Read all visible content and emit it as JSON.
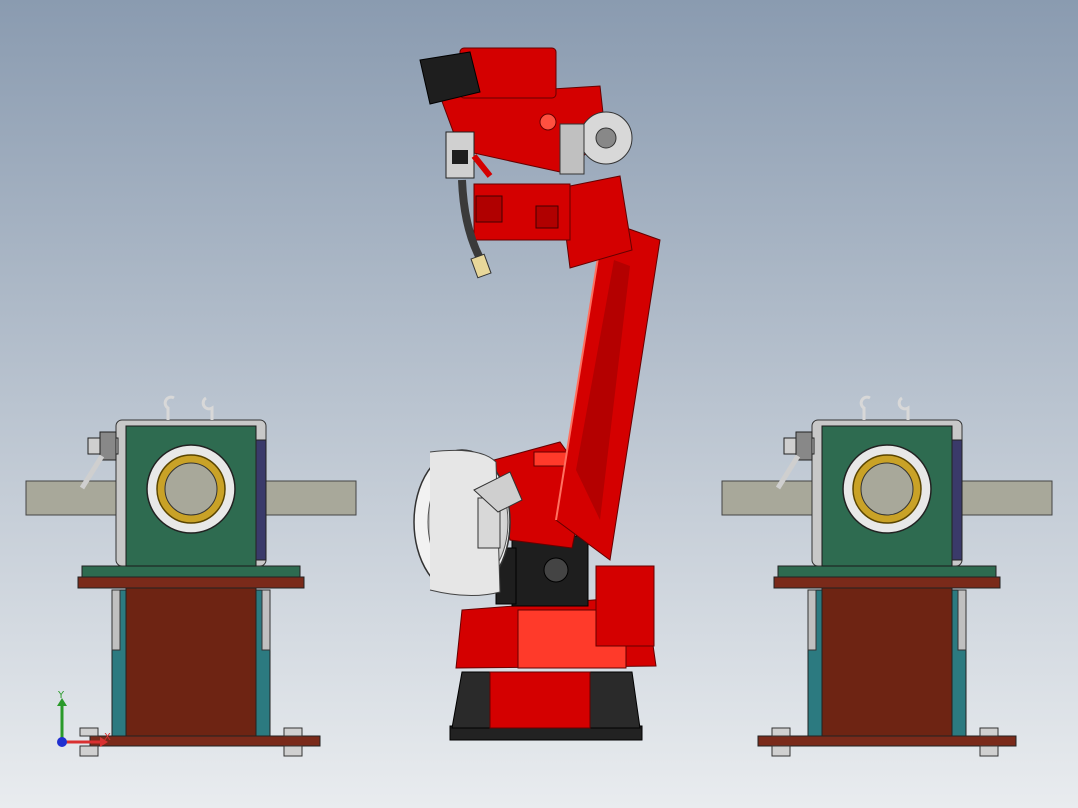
{
  "viewport": {
    "background_top": "#8a9bb0",
    "background_bottom": "#e9ecef"
  },
  "colors": {
    "robot_red": "#d40000",
    "robot_red_dark": "#8e0000",
    "robot_red_light": "#ff3a2a",
    "motor_black": "#1e1e1e",
    "positioner_green": "#2e6b50",
    "column_brown": "#6e2413",
    "base_plate_brown": "#7a2a1a",
    "bearing_gold": "#c9a227",
    "teal_leg": "#2c7a80",
    "workpiece_gray": "#a8a89a",
    "steel": "#c8c8c8"
  },
  "triad": {
    "x_label": "X",
    "y_label": "Y",
    "x_color": "#d93030",
    "y_color": "#2a9a2a",
    "z_color": "#2030d0"
  },
  "model": {
    "components": [
      "welding-robot",
      "positioner-left",
      "positioner-right",
      "welding-torch",
      "cable-drum"
    ]
  }
}
